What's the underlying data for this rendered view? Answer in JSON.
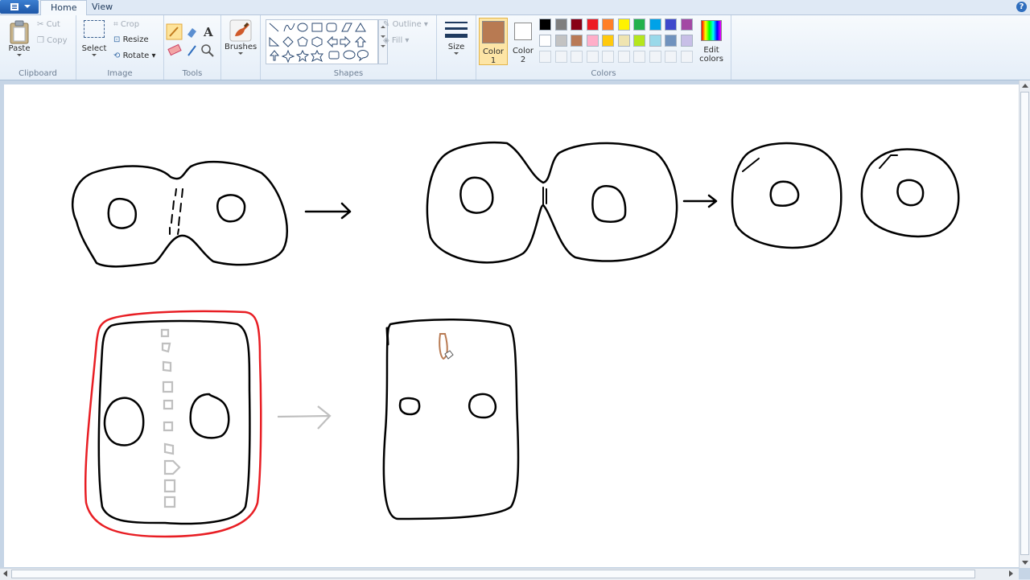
{
  "tabs": {
    "home": "Home",
    "view": "View"
  },
  "clipboard": {
    "paste": "Paste",
    "cut": "Cut",
    "copy": "Copy",
    "group": "Clipboard"
  },
  "image": {
    "select": "Select",
    "crop": "Crop",
    "resize": "Resize",
    "rotate": "Rotate",
    "group": "Image"
  },
  "tools": {
    "group": "Tools"
  },
  "brushes": {
    "label": "Brushes"
  },
  "shapes": {
    "outline": "Outline",
    "fill": "Fill",
    "group": "Shapes"
  },
  "size": {
    "label": "Size"
  },
  "colors": {
    "color1_line1": "Color",
    "color1_line2": "1",
    "color2_line1": "Color",
    "color2_line2": "2",
    "edit_line1": "Edit",
    "edit_line2": "colors",
    "group": "Colors",
    "color1_value": "#b87a52",
    "color2_value": "#ffffff",
    "palette_row1": [
      "#000000",
      "#7f7f7f",
      "#880015",
      "#ed1c24",
      "#ff7f27",
      "#fff200",
      "#22b14c",
      "#00a2e8",
      "#3f48cc",
      "#a349a4"
    ],
    "palette_row2": [
      "#ffffff",
      "#c3c3c3",
      "#b97a57",
      "#ffaec9",
      "#ffc90e",
      "#efe4b0",
      "#b5e61d",
      "#99d9ea",
      "#7092be",
      "#c8bfe7"
    ]
  }
}
